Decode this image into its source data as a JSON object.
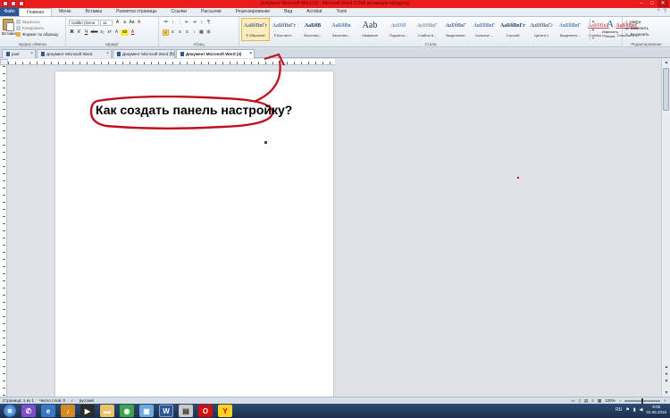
{
  "window": {
    "title": "Документ Microsoft Word (3) - Microsoft Word (Сбой активации продукта)",
    "controls": [
      "–",
      "□",
      "✕"
    ]
  },
  "ribbon": {
    "file_tab": "Файл",
    "tabs": [
      "Главная",
      "Меню",
      "Вставка",
      "Разметка страницы",
      "Ссылки",
      "Рассылки",
      "Рецензирование",
      "Вид",
      "Acrobat",
      "Tools"
    ],
    "active_tab": "Главная",
    "clipboard": {
      "paste_label": "Вставить",
      "items": [
        "Вырезать",
        "Копировать",
        "Формат по образцу"
      ],
      "group_name": "Буфер обмена"
    },
    "font": {
      "family": "Calibri (Осно",
      "size": "11",
      "group_name": "Шрифт",
      "buttons_row1": [
        "A",
        "a",
        "Aa",
        "A"
      ],
      "buttons_row2": [
        "Ж",
        "К",
        "Ч",
        "abc",
        "x₂",
        "x²",
        "A",
        "ab",
        "A"
      ]
    },
    "paragraph": {
      "group_name": "Абзац",
      "buttons_row1": [
        "≔",
        "⁝",
        "⋮",
        "⇤",
        "⇥",
        "↕",
        "¶"
      ],
      "buttons_row2": [
        "≡",
        "≡",
        "≡",
        "≡",
        "↕",
        "▦",
        "⊞"
      ]
    },
    "styles": {
      "group_name": "Стили",
      "items": [
        {
          "preview": "АаБбВвГг",
          "name": "¶ Обычный"
        },
        {
          "preview": "АаБбВвГг",
          "name": "¶ Без инте..."
        },
        {
          "preview": "АаБбВ",
          "name": "Заголово..."
        },
        {
          "preview": "АаБбВв",
          "name": "Заголово..."
        },
        {
          "preview": "Aab",
          "name": "Название"
        },
        {
          "preview": "АаБбВ",
          "name": "Подзагол..."
        },
        {
          "preview": "АаБбВвГ",
          "name": "Слабое в..."
        },
        {
          "preview": "АаБбВвГ",
          "name": "Выделение"
        },
        {
          "preview": "АаБбВвГ",
          "name": "Сильное ..."
        },
        {
          "preview": "АаБбВвГг",
          "name": "Строгий"
        },
        {
          "preview": "АаБбВвГг",
          "name": "Цитата 2"
        },
        {
          "preview": "АаБбВвГ",
          "name": "Выделенн..."
        },
        {
          "preview": "АаБбВвГ",
          "name": "Слабая сс..."
        },
        {
          "preview": "АаБбВвГ",
          "name": "Сильная с..."
        }
      ],
      "change_label": "Изменить стили"
    },
    "editing": {
      "group_name": "Редактирование",
      "items": [
        "Найти",
        "Заменить",
        "Выделить"
      ]
    }
  },
  "doc_tabs": [
    {
      "label": "рзат",
      "active": false
    },
    {
      "label": "Документ Microsoft Word",
      "active": false
    },
    {
      "label": "Документ Microsoft Word (2)",
      "active": false
    },
    {
      "label": "Документ Microsoft Word (3)",
      "active": true
    }
  ],
  "document": {
    "callout_text": "Как создать панель настройку?"
  },
  "statusbar": {
    "page": "Страница: 1 из 1",
    "words": "Число слов: 0",
    "language": "русский",
    "zoom": "100%"
  },
  "taskbar": {
    "apps": [
      "win",
      "viber",
      "explorer",
      "winamp",
      "media",
      "explorer-folders",
      "chrome",
      "photos",
      "word",
      "pdf",
      "opera",
      "yandex"
    ],
    "active_app": "word",
    "tray": {
      "lang": "RU",
      "time": "8:05",
      "date": "02.05.2016"
    }
  },
  "colors": {
    "titlebar": "#ea1c1c",
    "annotation": "#c0101e",
    "ribbon_file": "#2b5797",
    "selected_style": "#fcecc0"
  }
}
